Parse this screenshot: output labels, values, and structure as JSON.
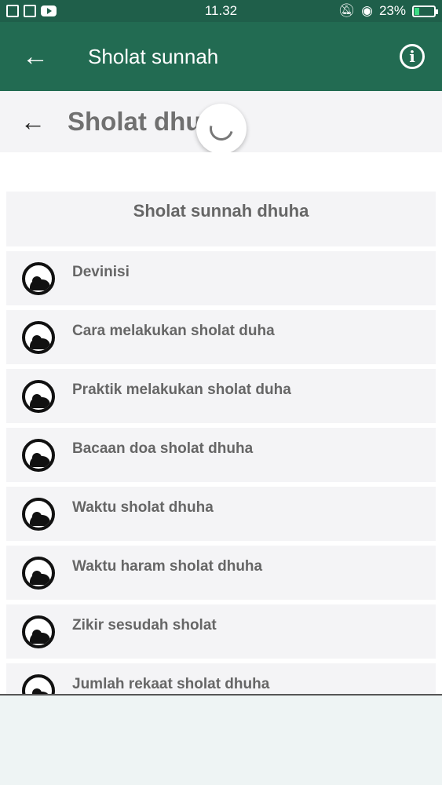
{
  "status_bar": {
    "time": "11.32",
    "battery": "23%",
    "battery_level": 0.23,
    "left_icons": [
      "notification-x-icon",
      "sim-icon",
      "youtube-icon"
    ],
    "right_icons": [
      "mute-bell-icon",
      "eye-icon",
      "battery-charging-icon"
    ]
  },
  "appbar": {
    "title": "Sholat sunnah",
    "back_icon": "arrow-back-icon",
    "info_icon": "info-icon",
    "color": "#226b52"
  },
  "subheader": {
    "title": "Sholat dhuha",
    "back_icon": "arrow-back-icon"
  },
  "section": {
    "title": "Sholat sunnah dhuha"
  },
  "items": [
    {
      "label": "Devinisi"
    },
    {
      "label": "Cara melakukan sholat duha"
    },
    {
      "label": "Praktik melakukan sholat duha"
    },
    {
      "label": "Bacaan doa sholat dhuha"
    },
    {
      "label": "Waktu sholat dhuha"
    },
    {
      "label": "Waktu haram sholat dhuha"
    },
    {
      "label": "Zikir sesudah sholat"
    },
    {
      "label": "Jumlah rekaat sholat dhuha"
    }
  ]
}
